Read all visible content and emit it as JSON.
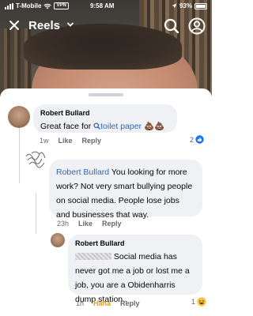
{
  "status_bar": {
    "carrier": "T-Mobile",
    "vpn": "VPN",
    "time": "9:58 AM",
    "battery": "93%"
  },
  "header": {
    "title": "Reels"
  },
  "comments": [
    {
      "author": "Robert Bullard",
      "text_prefix": "Great face for ",
      "search_term": "toilet paper",
      "emoji": "💩💩",
      "time": "1w",
      "like_label": "Like",
      "reply_label": "Reply",
      "reaction_count": "2"
    },
    {
      "mention": "Robert Bullard",
      "text": " You looking for more work? Not very smart bullying people on social media. People lose jobs and businesses that way.",
      "time": "23h",
      "like_label": "Like",
      "reply_label": "Reply"
    },
    {
      "author": "Robert Bullard",
      "text": "Social media has never got me a job or lost me a job, you are a Obidenharris dump station..",
      "time": "1h",
      "like_label": "Haha",
      "reply_label": "Reply",
      "reaction_count": "1"
    }
  ],
  "colors": {
    "bubble": "#eff1f4",
    "link": "#3565b8",
    "haha": "#e0a019",
    "meta": "#65676b"
  }
}
